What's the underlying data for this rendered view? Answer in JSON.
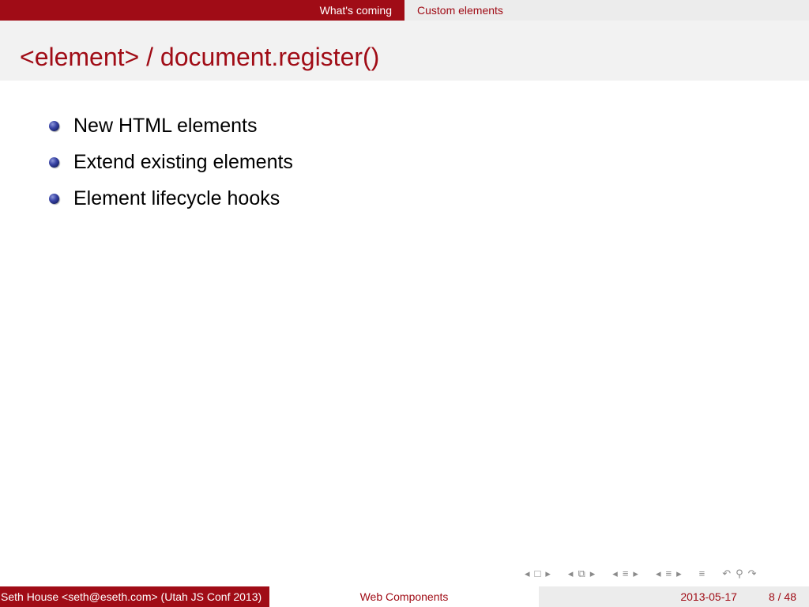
{
  "nav": {
    "sections": [
      "What's coming",
      "Custom elements"
    ]
  },
  "frame": {
    "title": "<element> / document.register()"
  },
  "bullets": [
    "New HTML elements",
    "Extend existing elements",
    "Element lifecycle hooks"
  ],
  "footer": {
    "author": "Seth House <seth@eseth.com>  (Utah JS Conf 2013)",
    "title": "Web Components",
    "date": "2013-05-17",
    "page": "8 / 48"
  },
  "colors": {
    "accent": "#a00c16",
    "header_bg": "#ececec",
    "title_band_bg": "#f2f2f2",
    "bullet_ball": "#2b3590"
  },
  "icons": [
    "frame-prev-icon",
    "frame-icon",
    "frame-next-icon",
    "subsection-prev-icon",
    "subsection-icon",
    "subsection-next-icon",
    "section-prev-icon",
    "section-icon",
    "section-next-icon",
    "doc-prev-icon",
    "doc-icon",
    "doc-next-icon",
    "outline-icon",
    "back-icon",
    "search-icon",
    "forward-icon"
  ]
}
